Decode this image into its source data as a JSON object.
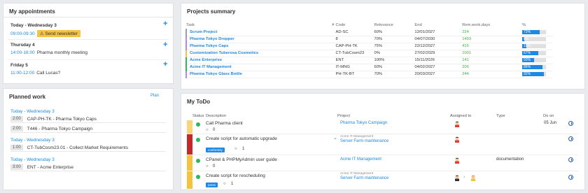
{
  "appointments": {
    "title": "My appointments",
    "days": [
      {
        "label": "Today - Wednesday 3",
        "time": "09:00-09:30",
        "text": "Send newsletter"
      },
      {
        "label": "Thursday 4",
        "time": "14:00-16:00",
        "text": "Pharma monthly meeting"
      },
      {
        "label": "Friday 5",
        "time": "11:00-12:00",
        "text": "Call Lucas?"
      }
    ]
  },
  "planned": {
    "title": "Planned work",
    "plan_label": "Plan",
    "groups": [
      {
        "day": "Today - Wednesday 3",
        "dur": "2:00",
        "text": "CAP-PH-TK - Pharma Tokyo Caps"
      },
      {
        "day": "",
        "dur": "2:00",
        "text": "T446 - Pharma Tokyo Campaign"
      },
      {
        "day": "Today - Wednesday 3",
        "dur": "1:00",
        "text": "CT-TubCosm23.01 - Collect Market Requirements"
      },
      {
        "day": "Today - Wednesday 3",
        "dur": "3:00",
        "text": "ENT - Acme Enterprise"
      }
    ]
  },
  "projects": {
    "title": "Projects summary",
    "headers": [
      "Task",
      "Code",
      "Relevance",
      "End",
      "Rem.work.days",
      "%"
    ],
    "rows": [
      {
        "task": "Scrum Project",
        "code": "AD-SC",
        "rel": "60%",
        "end": "12/01/2027",
        "days": "224",
        "pct": 73,
        "pct_label": "73%",
        "color": "#9e9e9e"
      },
      {
        "task": "Pharma Tokyo Dropper",
        "code": "8",
        "rel": "70%",
        "end": "04/07/2030",
        "days": "1493",
        "pct": 8,
        "pct_label": "8%",
        "color": "#c084e8"
      },
      {
        "task": "Pharma Tokyo Caps",
        "code": "CAP-PH-TK",
        "rel": "75%",
        "end": "22/12/2027",
        "days": "415",
        "pct": 18,
        "pct_label": "18%",
        "color": "#c084e8"
      },
      {
        "task": "Customization Tuberosa Cosmetics",
        "code": "CT-TubCosm23",
        "rel": "0%",
        "end": "27/02/2029",
        "days": "1001",
        "pct": 67,
        "pct_label": "67%",
        "color": "#f5c242"
      },
      {
        "task": "Acme Enterprise",
        "code": "ENT",
        "rel": "100%",
        "end": "15/11/2026",
        "days": "141",
        "pct": 50,
        "pct_label": "50%",
        "color": "#2eb85c"
      },
      {
        "task": "Acme IT Management",
        "code": "IT-MNG",
        "rel": "60%",
        "end": "04/02/2027",
        "days": "206",
        "pct": 86,
        "pct_label": "86%",
        "color": "#2eb85c"
      },
      {
        "task": "Pharma Tokyo Glass Bottle",
        "code": "PH-TK-BT",
        "rel": "70%",
        "end": "20/03/2027",
        "days": "244",
        "pct": 92,
        "pct_label": "92%",
        "color": "#c084e8"
      }
    ]
  },
  "todo": {
    "title": "My ToDo",
    "headers": {
      "status": "Status",
      "desc": "Description",
      "project": "Project",
      "assigned": "Assigned to",
      "type": "Type",
      "due": "Do on"
    },
    "rows": [
      {
        "title": "Call Pharma client",
        "project": "Pharma Tokyo Campaign",
        "sub": "",
        "comments": "0",
        "tag": "",
        "type": "",
        "due": "05 Jun",
        "strip": "#f5c242"
      },
      {
        "title": "Create script for automatic upgrade",
        "project": "Server Farm maintenance",
        "sub": "Acme IT Management",
        "comments": "1",
        "tag": "conformity",
        "type": "",
        "due": "",
        "strip": "#c62828"
      },
      {
        "title": "CPanel & PHPMyAdmin user guide",
        "project": "Acme IT Management",
        "sub": "",
        "comments": "0",
        "tag": "",
        "type": "documentation",
        "due": "",
        "strip": "#f5c242"
      },
      {
        "title": "Create script for rescheduling",
        "project": "Server Farm maintenance",
        "sub": "Acme IT Management",
        "comments": "1",
        "tag": "press",
        "type": "",
        "due": "",
        "strip": "#f5c242"
      }
    ]
  }
}
